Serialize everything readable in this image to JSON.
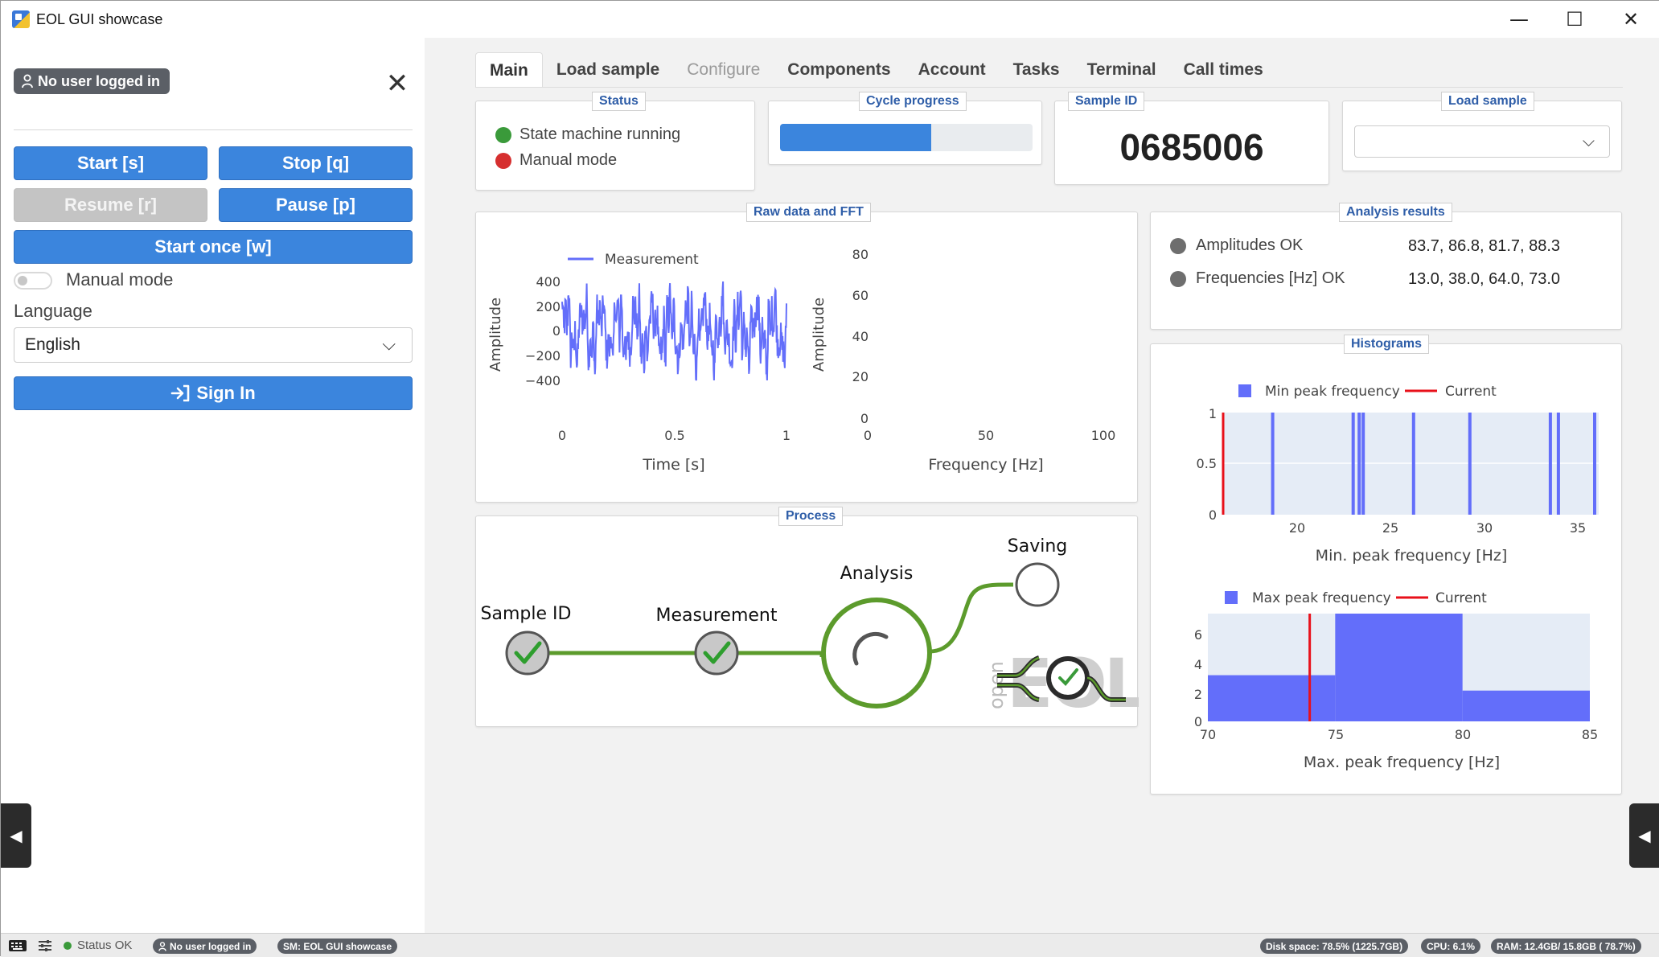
{
  "window": {
    "title": "EOL GUI showcase",
    "minimize": "—",
    "maximize": "☐",
    "close": "✕"
  },
  "sidebar": {
    "user_badge": "No user logged in",
    "close": "✕",
    "buttons": {
      "start": "Start [s]",
      "stop": "Stop [q]",
      "resume": "Resume [r]",
      "pause": "Pause [p]",
      "start_once": "Start once [w]"
    },
    "manual_mode_label": "Manual mode",
    "language_label": "Language",
    "language_value": "English",
    "sign_in": "Sign In",
    "collapse_arrow": "◀"
  },
  "tabs": [
    {
      "label": "Main",
      "active": true
    },
    {
      "label": "Load sample"
    },
    {
      "label": "Configure",
      "disabled": true
    },
    {
      "label": "Components"
    },
    {
      "label": "Account"
    },
    {
      "label": "Tasks"
    },
    {
      "label": "Terminal"
    },
    {
      "label": "Call times"
    }
  ],
  "status_card": {
    "title": "Status",
    "items": [
      {
        "label": "State machine running",
        "color": "#3a9a3a"
      },
      {
        "label": "Manual mode",
        "color": "#d62f2f"
      }
    ]
  },
  "cycle_progress": {
    "title": "Cycle progress",
    "fraction": 0.6
  },
  "sample_id": {
    "title": "Sample ID",
    "value": "0685006"
  },
  "load_sample": {
    "title": "Load sample",
    "value": ""
  },
  "raw_data": {
    "title": "Raw data and FFT",
    "chart_data": [
      {
        "type": "line",
        "legend": "Measurement",
        "xlabel": "Time [s]",
        "ylabel": "Amplitude",
        "xlim": [
          0,
          1
        ],
        "ylim": [
          -400,
          400
        ],
        "xticks": [
          "0",
          "0.5",
          "1"
        ],
        "yticks": [
          "400",
          "200",
          "0",
          "−200",
          "−400"
        ],
        "color": "#636efa"
      },
      {
        "type": "line",
        "xlabel": "Frequency [Hz]",
        "ylabel": "Amplitude",
        "xlim": [
          0,
          100
        ],
        "ylim": [
          0,
          80
        ],
        "xticks": [
          "0",
          "50",
          "100"
        ],
        "yticks": [
          "80",
          "60",
          "40",
          "20",
          "0"
        ]
      }
    ]
  },
  "analysis": {
    "title": "Analysis results",
    "rows": [
      {
        "label": "Amplitudes OK",
        "value": "83.7, 86.8, 81.7, 88.3"
      },
      {
        "label": "Frequencies [Hz] OK",
        "value": "13.0, 38.0, 64.0, 73.0"
      }
    ]
  },
  "histograms": {
    "title": "Histograms",
    "chart_data": [
      {
        "type": "bar",
        "legend": [
          "Min peak frequency",
          "Current"
        ],
        "xlabel": "Min. peak frequency [Hz]",
        "xlim": [
          17.5,
          36.2
        ],
        "ylim": [
          0,
          1
        ],
        "xticks": [
          "20",
          "25",
          "30",
          "35"
        ],
        "yticks": [
          "1",
          "0.5",
          "0"
        ],
        "bars": [
          20.0,
          24.0,
          24.3,
          24.5,
          27.0,
          29.8,
          33.8,
          34.2,
          36.0
        ],
        "current": 17.5,
        "colors": {
          "bars": "#636efa",
          "current": "#e8101a"
        }
      },
      {
        "type": "bar",
        "legend": [
          "Max peak frequency",
          "Current"
        ],
        "xlabel": "Max. peak frequency [Hz]",
        "xlim": [
          70,
          85
        ],
        "ylim": [
          0,
          7
        ],
        "xticks": [
          "70",
          "75",
          "80",
          "85"
        ],
        "yticks": [
          "6",
          "4",
          "2",
          "0"
        ],
        "bins": [
          {
            "from": 70,
            "to": 75,
            "value": 3
          },
          {
            "from": 75,
            "to": 80,
            "value": 7
          },
          {
            "from": 80,
            "to": 85,
            "value": 2
          }
        ],
        "current": 74,
        "colors": {
          "bars": "#636efa",
          "current": "#e8101a"
        }
      }
    ]
  },
  "process": {
    "title": "Process",
    "steps": [
      "Sample ID",
      "Measurement",
      "Analysis",
      "Saving"
    ],
    "logo_text_vertical": "open",
    "logo_text": "EOL"
  },
  "statusbar": {
    "status": "Status OK",
    "user": "No user logged in",
    "sm": "SM: EOL GUI showcase",
    "disk": "Disk space: 78.5% (1225.7GB)",
    "cpu": "CPU: 6.1%",
    "ram": "RAM: 12.4GB/ 15.8GB ( 78.7%)"
  }
}
